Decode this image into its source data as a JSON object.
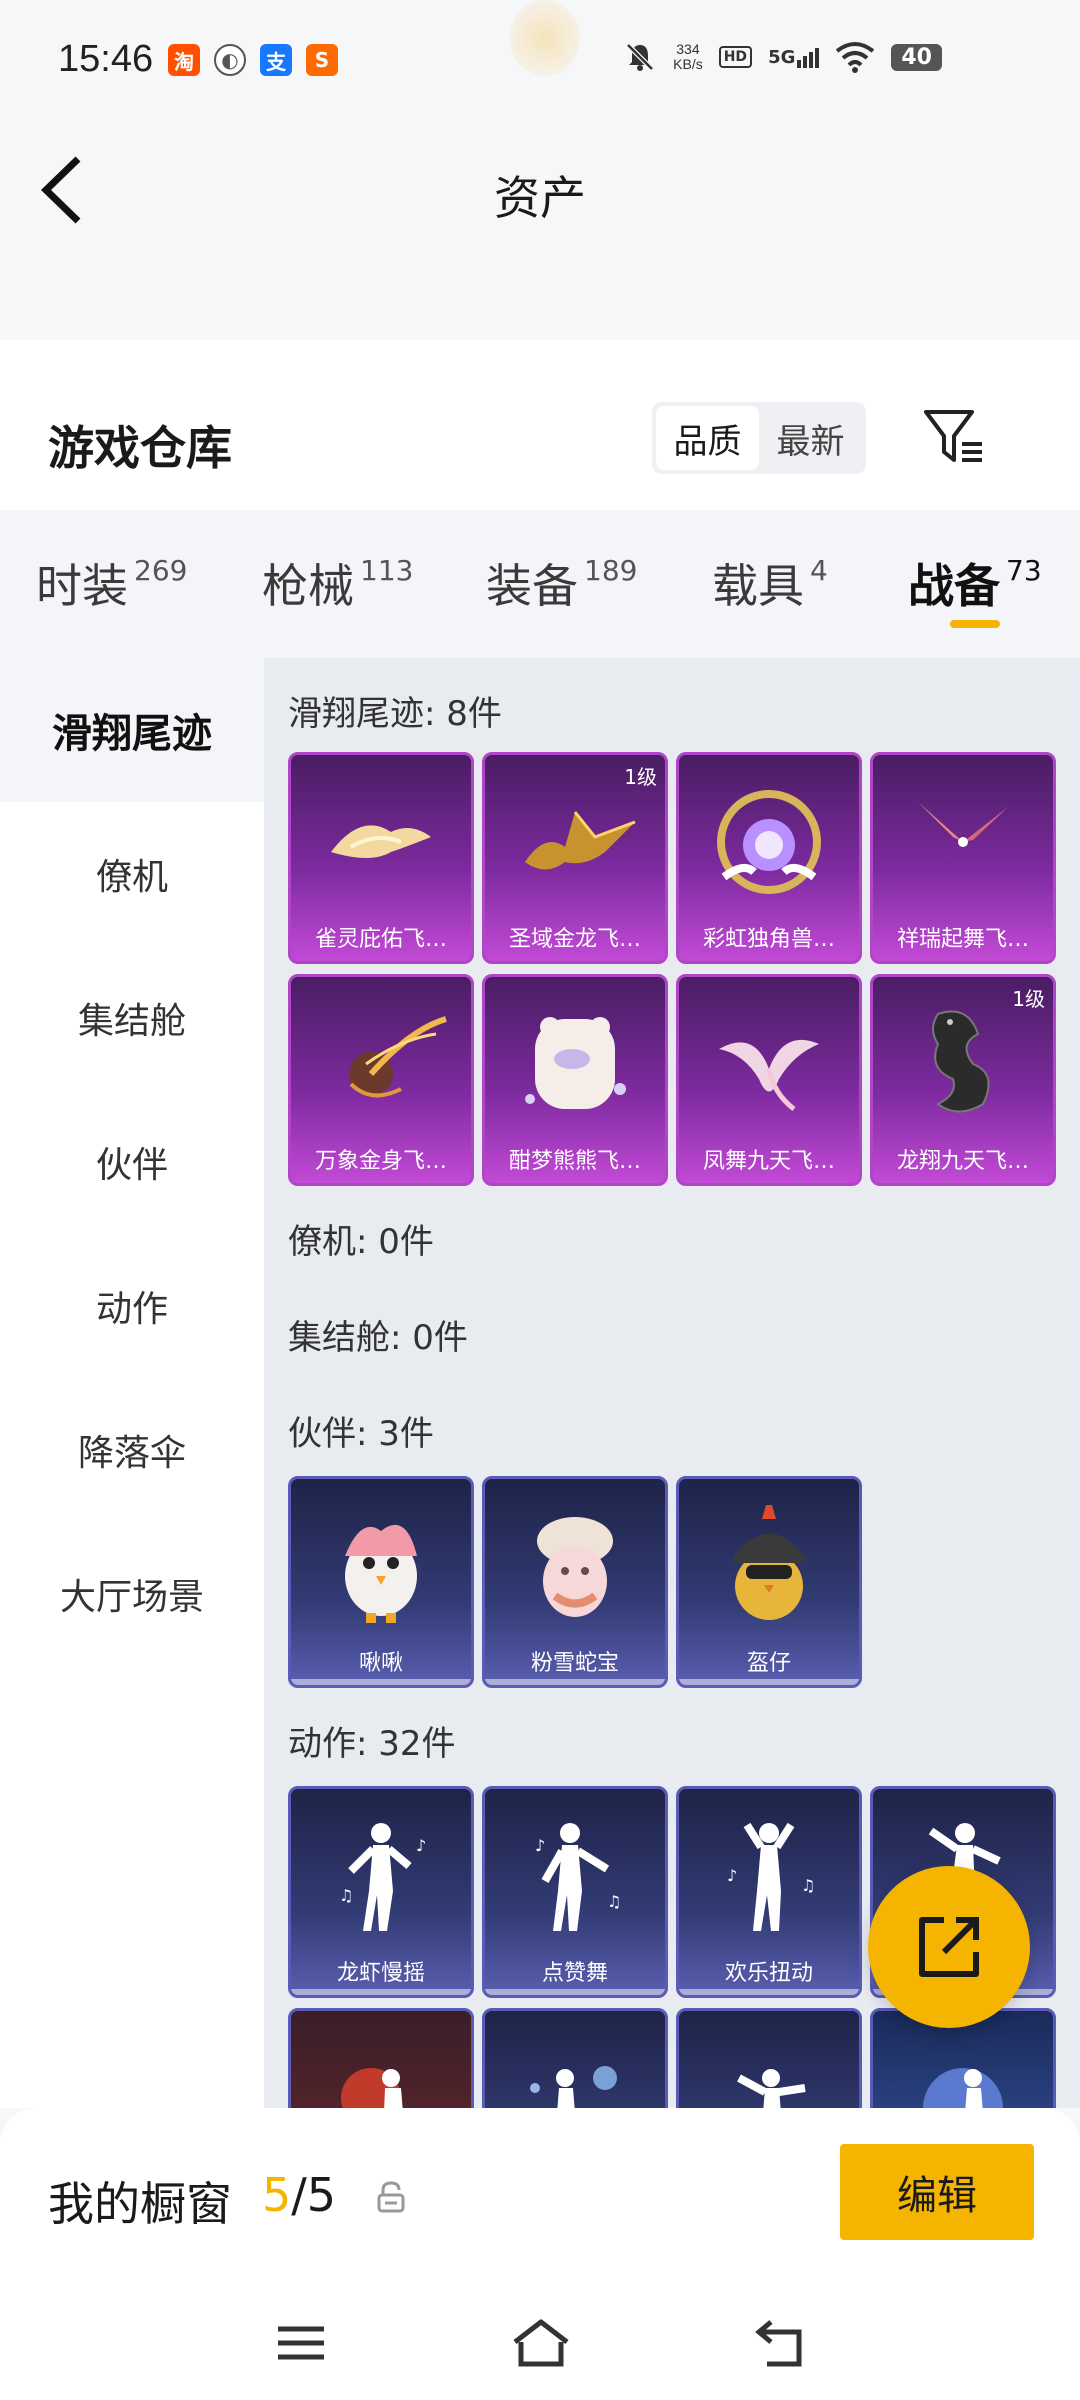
{
  "status_bar": {
    "time": "15:46",
    "apps": [
      {
        "name": "taobao",
        "glyph": "淘",
        "color": "#ff5000"
      },
      {
        "name": "planet",
        "glyph": "◐",
        "color": "#555555"
      },
      {
        "name": "alipay",
        "glyph": "支",
        "color": "#1677ff"
      },
      {
        "name": "sogou",
        "glyph": "S",
        "color": "#ff6a00"
      }
    ],
    "net_speed_value": "334",
    "net_speed_unit": "KB/s",
    "hd": "HD",
    "signal": "5G",
    "battery": "40"
  },
  "header": {
    "title": "资产"
  },
  "warehouse": {
    "title": "游戏仓库",
    "sort_options": [
      "品质",
      "最新"
    ]
  },
  "tabs": [
    {
      "label": "时装",
      "count": "269"
    },
    {
      "label": "枪械",
      "count": "113"
    },
    {
      "label": "装备",
      "count": "189"
    },
    {
      "label": "载具",
      "count": "4"
    },
    {
      "label": "战备",
      "count": "73"
    }
  ],
  "sidebar": [
    "滑翔尾迹",
    "僚机",
    "集结舱",
    "伙伴",
    "动作",
    "降落伞",
    "大厅场景"
  ],
  "sections": {
    "glide": {
      "label": "滑翔尾迹: 8件",
      "items": [
        {
          "name": "雀灵庇佑飞…",
          "level": ""
        },
        {
          "name": "圣域金龙飞…",
          "level": "1级"
        },
        {
          "name": "彩虹独角兽…",
          "level": ""
        },
        {
          "name": "祥瑞起舞飞…",
          "level": ""
        },
        {
          "name": "万象金身飞…",
          "level": ""
        },
        {
          "name": "酣梦熊熊飞…",
          "level": ""
        },
        {
          "name": "凤舞九天飞…",
          "level": ""
        },
        {
          "name": "龙翔九天飞…",
          "level": "1级"
        }
      ]
    },
    "wingman": {
      "label": "僚机: 0件"
    },
    "pod": {
      "label": "集结舱: 0件"
    },
    "partner": {
      "label": "伙伴: 3件",
      "items": [
        {
          "name": "啾啾"
        },
        {
          "name": "粉雪蛇宝"
        },
        {
          "name": "盔仔"
        }
      ]
    },
    "emote": {
      "label": "动作: 32件",
      "items": [
        {
          "name": "龙虾慢摇"
        },
        {
          "name": "点赞舞"
        },
        {
          "name": "欢乐扭动"
        },
        {
          "name": ""
        }
      ]
    }
  },
  "bottom_bar": {
    "label": "我的橱窗",
    "current": "5",
    "separator": "/",
    "total": "5",
    "edit_label": "编辑"
  },
  "colors": {
    "accent": "#f5b400",
    "epic_card": "#7c2a9e",
    "rare_card": "#323b74"
  }
}
